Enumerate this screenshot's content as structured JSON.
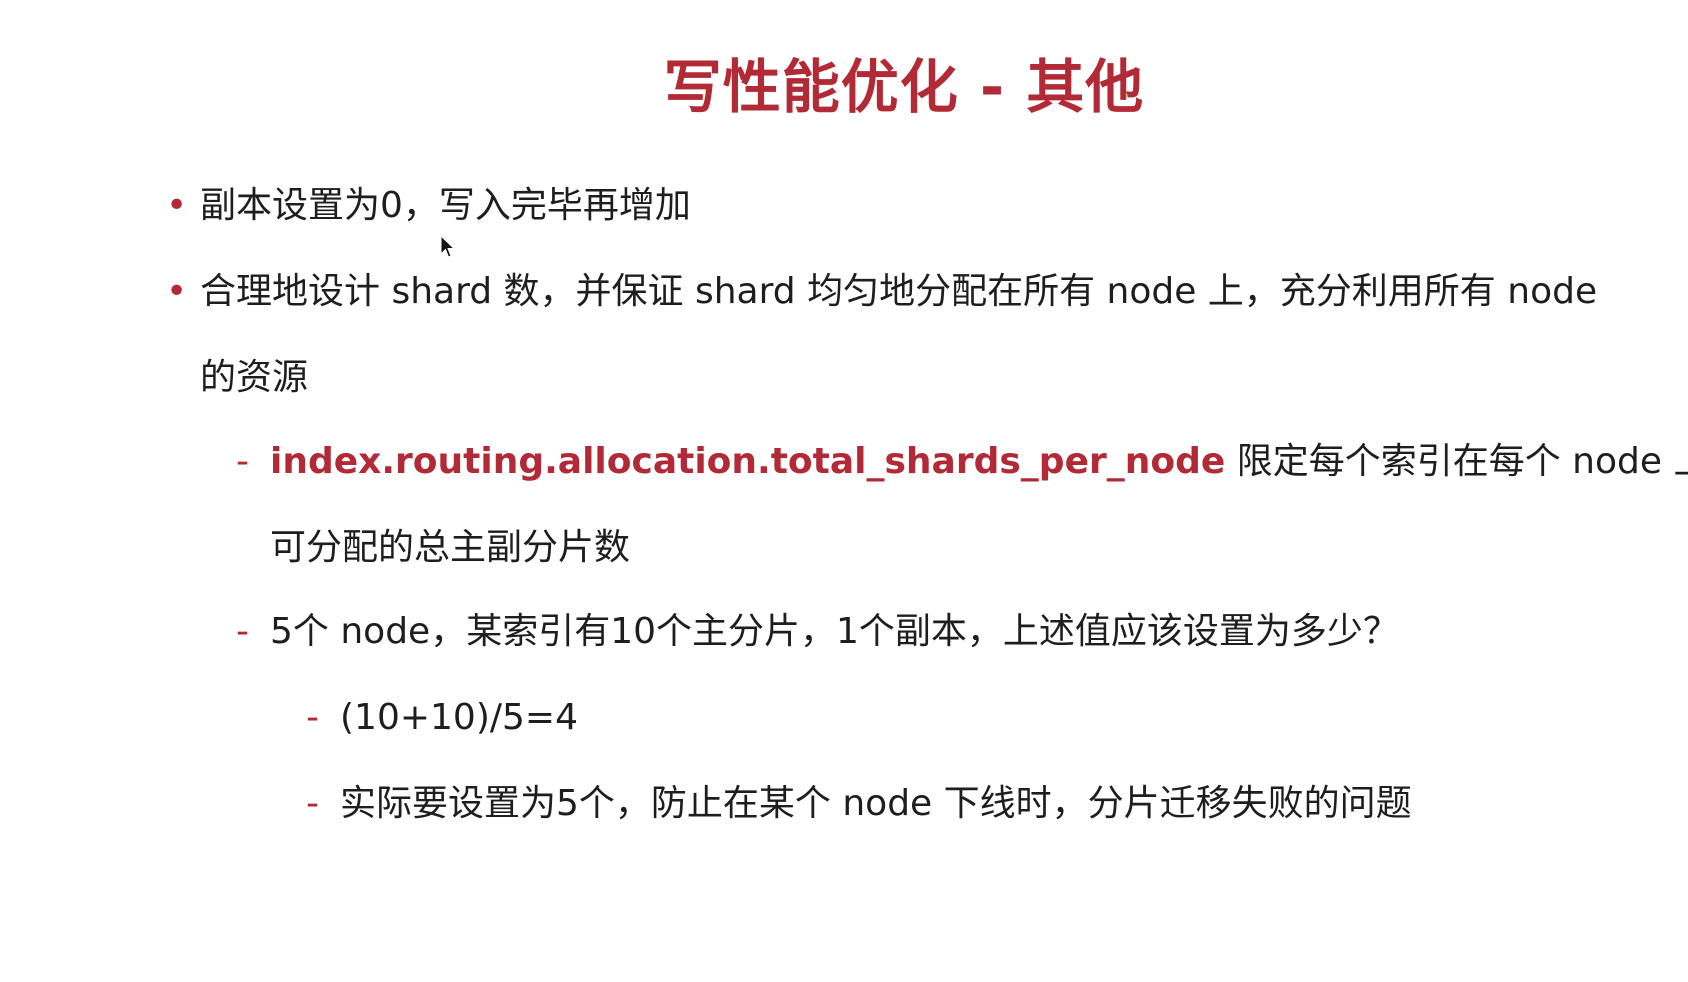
{
  "slide": {
    "title": "写性能优化 - 其他",
    "bullets": [
      {
        "text": "副本设置为0，写入完毕再增加"
      },
      {
        "line1": "合理地设计 shard 数，并保证 shard 均匀地分配在所有 node 上，充分利用所有 node",
        "line2": "的资源",
        "subitems": [
          {
            "highlight": "index.routing.allocation.total_shards_per_node",
            "rest": " 限定每个索引在每个 node 上",
            "line2": "可分配的总主副分片数"
          },
          {
            "text": "5个 node，某索引有10个主分片，1个副本，上述值应该设置为多少？",
            "subitems": [
              {
                "text": "(10+10)/5=4"
              },
              {
                "text": "实际要设置为5个，防止在某个 node 下线时，分片迁移失败的问题"
              }
            ]
          }
        ]
      }
    ]
  },
  "markers": {
    "bullet": "•",
    "dash": "-"
  },
  "colors": {
    "accent": "#b22a36",
    "text": "#1e1e1e",
    "background": "#ffffff"
  }
}
